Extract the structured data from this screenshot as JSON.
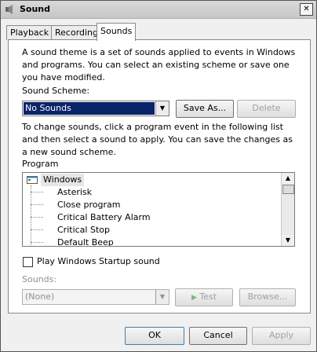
{
  "window": {
    "title": "Sound",
    "close_glyph": "✕"
  },
  "tabs": [
    {
      "label": "Playback"
    },
    {
      "label": "Recording"
    },
    {
      "label": "Sounds"
    }
  ],
  "intro_text": "A sound theme is a set of sounds applied to events in Windows and programs.  You can select an existing scheme or save one you have modified.",
  "scheme": {
    "label": "Sound Scheme:",
    "value": "No Sounds",
    "save_as": "Save As...",
    "delete": "Delete"
  },
  "instructions": "To change sounds, click a program event in the following list and then select a sound to apply.  You can save the changes as a new sound scheme.",
  "program": {
    "label": "Program",
    "group": "Windows",
    "items": [
      "Asterisk",
      "Close program",
      "Critical Battery Alarm",
      "Critical Stop",
      "Default Beep"
    ]
  },
  "startup": {
    "label": "Play Windows Startup sound",
    "checked": false
  },
  "sounds": {
    "label": "Sounds:",
    "value": "(None)",
    "test": "Test",
    "browse": "Browse..."
  },
  "footer": {
    "ok": "OK",
    "cancel": "Cancel",
    "apply": "Apply"
  },
  "icons": {
    "dropdown_arrow": "▼",
    "scroll_up": "▲",
    "scroll_down": "▼",
    "play": "▶"
  }
}
